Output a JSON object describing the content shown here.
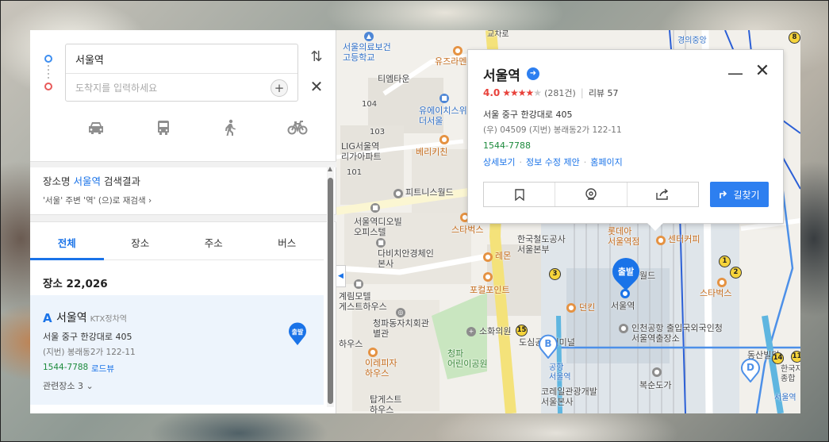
{
  "route": {
    "from_value": "서울역",
    "to_placeholder": "도착지를 입력하세요",
    "modes": [
      "car",
      "bus",
      "walk",
      "bike"
    ]
  },
  "search_summary": {
    "prefix": "장소명 ",
    "keyword": "서울역",
    "suffix": " 검색결과",
    "research": "'서울' 주변 '역' (으)로 재검색 ›"
  },
  "tabs": [
    "전체",
    "장소",
    "주소",
    "버스"
  ],
  "count_label": "장소 22,026",
  "result": {
    "letter": "A",
    "name": "서울역",
    "category": "KTX정차역",
    "address": "서울 중구 한강대로 405",
    "jibun": "(지번) 봉래동2가 122-11",
    "tel": "1544-7788",
    "roadview": "로드뷰",
    "related": "관련장소 3 ⌄",
    "pin_label": "출발"
  },
  "popup": {
    "title": "서울역",
    "score": "4.0",
    "stars_on": "★★★★",
    "stars_off": "★",
    "rating_count": "(281건)",
    "review": "리뷰 57",
    "address": "서울 중구 한강대로 405",
    "jibun": "(우) 04509   (지번) 봉래동2가 122-11",
    "tel": "1544-7788",
    "links": [
      "상세보기",
      "정보 수정 제안",
      "홈페이지"
    ],
    "go_label": "길찾기"
  },
  "map": {
    "start_label": "출발",
    "labels": {
      "l1": "서울의료보건\n고등학교",
      "l2": "유즈라멘",
      "l3": "티엠타운",
      "l4": "104",
      "l5": "유에이치스위\n더서울",
      "l6": "103",
      "l7": "LIG서울역\n리가아파트",
      "l8": "베리키친",
      "l9": "101",
      "l10": "피트니스월드",
      "l11": "서울역디오빌\n오피스텔",
      "l12": "스타벅스",
      "l13": "다비치안경체인\n본사",
      "l14": "레몬",
      "l15": "한국철도공사\n서울본부",
      "l16": "롯데아\n서울역점",
      "l17": "센터커피",
      "l18": "계림모텔\n게스트하우스",
      "l19": "청파동자치회관\n별관",
      "l20": "소화의원",
      "l21": "포컬포인트",
      "l22": "던킨",
      "l23": "서울역",
      "l24": "인천공항 출입국외국인청\n서울역출장소",
      "l25": "스타벅스",
      "l26": "도심공항터미널",
      "l27": "이레피자\n하우스",
      "l28": "청파\n어린이공원",
      "l29": "동산빌딩",
      "l30": "한국지\n종합",
      "l31": "코레일관광개발\n서울본사",
      "l32": "복순도가",
      "l33": "탑게스트\n하우스",
      "l34": "공항\n서울역",
      "l35": "서울역",
      "l36": "경의중앙",
      "l37": "교차로",
      "l38": "하우스",
      "l39": "월드"
    },
    "route_nums": [
      "3",
      "2",
      "1",
      "15",
      "14",
      "11",
      "8"
    ],
    "markers": [
      "B",
      "D"
    ]
  }
}
